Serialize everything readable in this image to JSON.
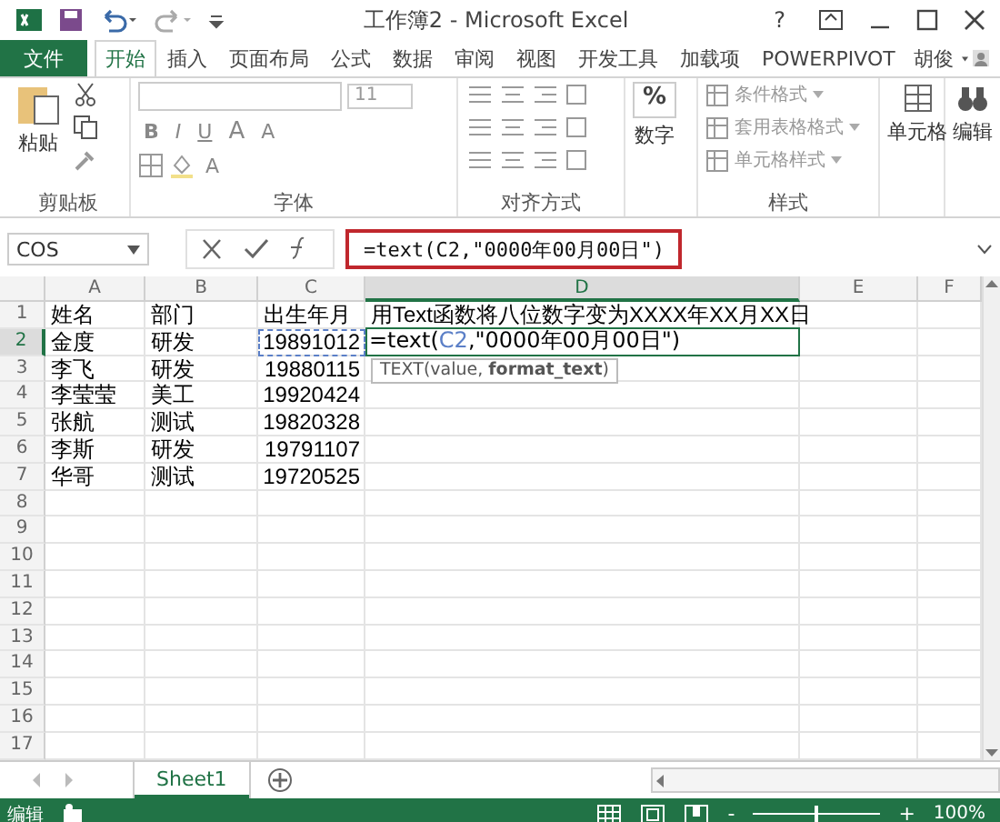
{
  "window": {
    "title": "工作簿2 - Microsoft Excel",
    "help": "?"
  },
  "ribbon_tabs": [
    {
      "label": "文件",
      "kind": "file",
      "selected": false
    },
    {
      "label": "开始",
      "kind": "tab",
      "selected": true
    },
    {
      "label": "插入",
      "kind": "tab",
      "selected": false
    },
    {
      "label": "页面布局",
      "kind": "tab",
      "selected": false
    },
    {
      "label": "公式",
      "kind": "tab",
      "selected": false
    },
    {
      "label": "数据",
      "kind": "tab",
      "selected": false
    },
    {
      "label": "审阅",
      "kind": "tab",
      "selected": false
    },
    {
      "label": "视图",
      "kind": "tab",
      "selected": false
    },
    {
      "label": "开发工具",
      "kind": "tab",
      "selected": false
    },
    {
      "label": "加载项",
      "kind": "tab",
      "selected": false
    },
    {
      "label": "POWERPIVOT",
      "kind": "tab",
      "selected": false
    }
  ],
  "user": {
    "name": "胡俊"
  },
  "ribbon": {
    "paste": "粘贴",
    "font_size": "11",
    "font_buttons": [
      "B",
      "I",
      "U"
    ],
    "grow_font": "A",
    "shrink_font": "A",
    "font_color": "A",
    "number_icon": "%",
    "number_label": "数字",
    "styles": [
      "条件格式",
      "套用表格格式",
      "单元格样式"
    ],
    "cells": "单元格",
    "editing": "编辑",
    "groups": [
      "剪贴板",
      "字体",
      "对齐方式",
      "样式"
    ]
  },
  "formula_bar": {
    "name_box": "COS",
    "formula": "=text(C2,\"0000年00月00日\")",
    "highlighted": true
  },
  "columns": [
    {
      "label": "A",
      "selected": false
    },
    {
      "label": "B",
      "selected": false
    },
    {
      "label": "C",
      "selected": false
    },
    {
      "label": "D",
      "selected": true
    },
    {
      "label": "E",
      "selected": false
    },
    {
      "label": "F",
      "selected": false
    }
  ],
  "rows": [
    {
      "num": "1",
      "selected": false,
      "cells": [
        "姓名",
        "部门",
        "出生年月",
        "用Text函数将八位数字变为XXXX年XX月XX日"
      ]
    },
    {
      "num": "2",
      "selected": true,
      "cells": [
        "金度",
        "研发",
        {
          "text": "19891012",
          "kind": "number",
          "referenced": true
        }
      ]
    },
    {
      "num": "3",
      "selected": false,
      "cells": [
        "李飞",
        "研发",
        {
          "text": "19880115",
          "kind": "number"
        }
      ]
    },
    {
      "num": "4",
      "selected": false,
      "cells": [
        "李莹莹",
        "美工",
        {
          "text": "19920424",
          "kind": "number"
        }
      ]
    },
    {
      "num": "5",
      "selected": false,
      "cells": [
        "张航",
        "测试",
        {
          "text": "19820328",
          "kind": "number"
        }
      ]
    },
    {
      "num": "6",
      "selected": false,
      "cells": [
        "李斯",
        "研发",
        {
          "text": "19791107",
          "kind": "number"
        }
      ]
    },
    {
      "num": "7",
      "selected": false,
      "cells": [
        "华哥",
        "测试",
        {
          "text": "19720525",
          "kind": "number"
        }
      ]
    },
    {
      "num": "8",
      "selected": false,
      "cells": []
    },
    {
      "num": "9",
      "selected": false,
      "cells": []
    },
    {
      "num": "10",
      "selected": false,
      "cells": []
    },
    {
      "num": "11",
      "selected": false,
      "cells": []
    },
    {
      "num": "12",
      "selected": false,
      "cells": []
    },
    {
      "num": "13",
      "selected": false,
      "cells": []
    },
    {
      "num": "14",
      "selected": false,
      "cells": []
    },
    {
      "num": "15",
      "selected": false,
      "cells": []
    },
    {
      "num": "16",
      "selected": false,
      "cells": []
    },
    {
      "num": "17",
      "selected": false,
      "cells": []
    }
  ],
  "edit_cell": {
    "parts": [
      "=text(",
      "C2",
      ",\"0000年00月00日\")"
    ],
    "tooltip": "TEXT(value, **format_text**)"
  },
  "sheet_tabs": [
    {
      "label": "Sheet1",
      "selected": true
    }
  ],
  "status_bar": {
    "mode": "编辑",
    "zoom_out": "-",
    "zoom_in": "+",
    "zoom": "100%",
    "zoom_slider": {
      "level": 0.5
    }
  }
}
